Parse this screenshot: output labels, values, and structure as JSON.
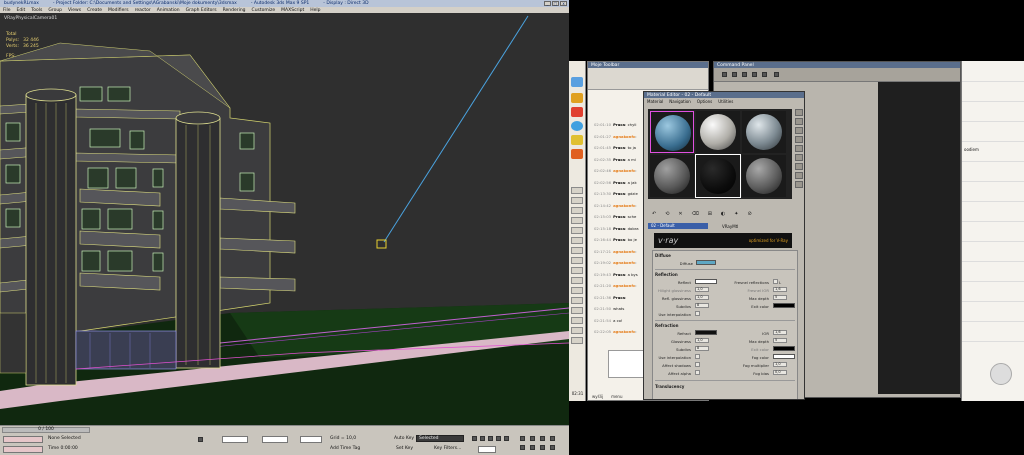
{
  "max": {
    "title_parts": [
      "budynekRLmax",
      "- Project Folder: C:\\Documents and Settings\\AGrabanski\\Moje dokumenty\\3dsmax",
      "- Autodesk 3ds Max 9 SP1",
      "- Display : Direct 3D"
    ],
    "menu": [
      "File",
      "Edit",
      "Tools",
      "Group",
      "Views",
      "Create",
      "Modifiers",
      "reactor",
      "Animation",
      "Graph Editors",
      "Rendering",
      "Customize",
      "MAXScript",
      "Help"
    ],
    "viewport_label": "VRayPhysicalCamera01",
    "stats": {
      "total_label": "Total",
      "polys_label": "Polys:",
      "polys_value": "32 446",
      "verts_label": "Verts:",
      "verts_value": "36 245",
      "fps_label": "FPS:"
    },
    "status": {
      "frame_counter": "0 / 100",
      "selection": "None Selected",
      "time": "Time 0:00:00",
      "grid": "Grid = 10,0",
      "auto_key": "Auto Key",
      "selected_dropdown": "Selected",
      "set_key": "Set Key",
      "key_filters": "Key Filters...",
      "add_time_tag": "Add Time Tag"
    }
  },
  "chat": {
    "title": "Moje Toolbar",
    "rows": [
      {
        "time": "02:01:10",
        "name": "Praca",
        "text": ": chyli",
        "orange": false
      },
      {
        "time": "02:01:27",
        "name": "agnakonfc",
        "text": ":",
        "orange": true
      },
      {
        "time": "02:01:45",
        "name": "Praca",
        "text": ": to ja",
        "orange": false
      },
      {
        "time": "02:02:35",
        "name": "Praca",
        "text": ": a mi",
        "orange": false
      },
      {
        "time": "02:02:46",
        "name": "agnakonfc",
        "text": ":",
        "orange": true
      },
      {
        "time": "02:02:56",
        "name": "Praca",
        "text": ": a jak",
        "orange": false
      },
      {
        "time": "02:13:30",
        "name": "Praca",
        "text": ": gdzie",
        "orange": false
      },
      {
        "time": "02:14:42",
        "name": "agnakonfc",
        "text": ":",
        "orange": true
      },
      {
        "time": "02:15:03",
        "name": "Praca",
        "text": ": sche",
        "orange": false
      },
      {
        "time": "02:15:18",
        "name": "Praca",
        "text": ": dobra",
        "orange": false
      },
      {
        "time": "02:16:44",
        "name": "Praca",
        "text": ": bo je",
        "orange": false
      },
      {
        "time": "02:17:21",
        "name": "agnakonfc",
        "text": ":",
        "orange": true
      },
      {
        "time": "02:19:02",
        "name": "agnakonfc",
        "text": ":",
        "orange": true
      },
      {
        "time": "02:19:43",
        "name": "Praca",
        "text": ": a bys",
        "orange": false
      },
      {
        "time": "02:21:20",
        "name": "agnakonfc",
        "text": ":",
        "orange": true
      },
      {
        "time": "02:21:36",
        "name": "Praca",
        "text": ":",
        "orange": false
      },
      {
        "time": "02:21:50",
        "name": "",
        "text": "whats",
        "orange": false
      },
      {
        "time": "02:21:54",
        "name": "",
        "text": "a co!",
        "orange": false
      },
      {
        "time": "02:22:05",
        "name": "agnakonfc",
        "text": ":",
        "orange": true
      }
    ],
    "bottom": [
      "wyślij",
      "menu"
    ],
    "clock": "02:31"
  },
  "cmdpanel": {
    "title": "Command Panel"
  },
  "sidewin": {
    "snippet": "oodiem"
  },
  "mat_editor": {
    "title": "Material Editor - 02 - Default",
    "menu": [
      "Material",
      "Navigation",
      "Options",
      "Utilities"
    ],
    "tools": [
      "↶",
      "⟲",
      "✕",
      "⌫",
      "⊞",
      "◐",
      "✦",
      "⊘"
    ],
    "name_value": "02 - Default",
    "type_value": "VRayMtl",
    "banner_logo": "v·ray",
    "banner_text": "optimized for V-Ray",
    "sections": {
      "diffuse": "Diffuse",
      "reflection": "Reflection",
      "refraction": "Refraction",
      "translucency": "Translucency"
    },
    "diffuse_label": "Diffuse",
    "diffuse_color": "#5ea7c4",
    "reflection_params": [
      {
        "label": "Reflect",
        "value": ""
      },
      {
        "label": "Hilight glossiness",
        "value": "1,0"
      },
      {
        "label": "Refl. glossiness",
        "value": "1,0"
      },
      {
        "label": "Subdivs",
        "value": "8"
      },
      {
        "label": "Use interpolation",
        "value": ""
      }
    ],
    "reflection_right": [
      {
        "label": "Fresnel reflections",
        "value": "L"
      },
      {
        "label": "Fresnel IOR",
        "value": "1,6"
      },
      {
        "label": "Max depth",
        "value": "5"
      },
      {
        "label": "Exit color",
        "value": ""
      }
    ],
    "refraction_params": [
      {
        "label": "Refract",
        "value": ""
      },
      {
        "label": "Glossiness",
        "value": "1,0"
      },
      {
        "label": "Subdivs",
        "value": "8"
      },
      {
        "label": "Use interpolation",
        "value": ""
      },
      {
        "label": "Affect shadows",
        "value": ""
      },
      {
        "label": "Affect alpha",
        "value": ""
      }
    ],
    "refraction_right": [
      {
        "label": "IOR",
        "value": "1,6"
      },
      {
        "label": "Max depth",
        "value": "5"
      },
      {
        "label": "Exit color",
        "value": ""
      },
      {
        "label": "Fog color",
        "value": ""
      },
      {
        "label": "Fog multiplier",
        "value": "1,0"
      },
      {
        "label": "Fog bias",
        "value": "0,0"
      }
    ]
  }
}
